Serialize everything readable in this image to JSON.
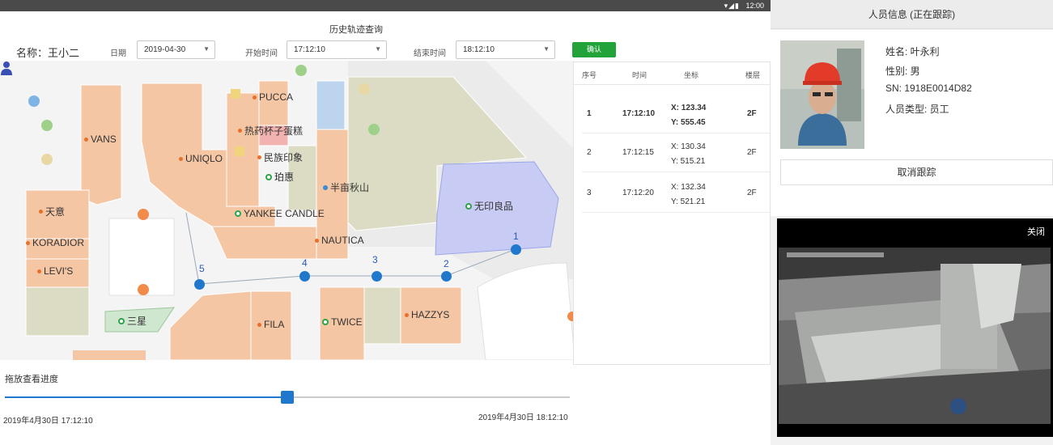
{
  "status_bar": {
    "icons": "▾◢▮",
    "time": "12:00"
  },
  "header": {
    "title": "历史轨迹查询"
  },
  "filters": {
    "name_label": "名称：王小二",
    "date_label": "日期",
    "date_value": "2019-04-30",
    "start_label": "开始时间",
    "start_value": "17:12:10",
    "end_label": "结束时间",
    "end_value": "18:12:10",
    "confirm_label": "确认"
  },
  "map": {
    "pois": [
      {
        "name": "PUCCA",
        "kind": "shop"
      },
      {
        "name": "VANS",
        "kind": "shop"
      },
      {
        "name": "热药杯子蛋糕",
        "kind": "shop"
      },
      {
        "name": "UNIQLO",
        "kind": "shop"
      },
      {
        "name": "民族印象",
        "kind": "shop"
      },
      {
        "name": "珀惠",
        "kind": "service"
      },
      {
        "name": "半亩秋山",
        "kind": "info"
      },
      {
        "name": "天意",
        "kind": "shop"
      },
      {
        "name": "YANKEE CANDLE",
        "kind": "service"
      },
      {
        "name": "无印良品",
        "kind": "service"
      },
      {
        "name": "KORADIOR",
        "kind": "shop"
      },
      {
        "name": "NAUTICA",
        "kind": "shop"
      },
      {
        "name": "LEVI'S",
        "kind": "shop"
      },
      {
        "name": "三星",
        "kind": "service"
      },
      {
        "name": "FILA",
        "kind": "shop"
      },
      {
        "name": "TWICE",
        "kind": "service"
      },
      {
        "name": "HAZZYS",
        "kind": "shop"
      }
    ],
    "markers": [
      "1",
      "2",
      "3",
      "4",
      "5"
    ]
  },
  "table": {
    "headers": [
      "序号",
      "时间",
      "坐标",
      "楼层"
    ],
    "rows": [
      {
        "index": "1",
        "time": "17:12:10",
        "x": "X: 123.34",
        "y": "Y: 555.45",
        "floor": "2F"
      },
      {
        "index": "2",
        "time": "17:12:15",
        "x": "X: 130.34",
        "y": "Y: 515.21",
        "floor": "2F"
      },
      {
        "index": "3",
        "time": "17:12:20",
        "x": "X: 132.34",
        "y": "Y: 521.21",
        "floor": "2F"
      }
    ]
  },
  "playback": {
    "label": "拖放查看进度",
    "start": "2019年4月30日 17:12:10",
    "end": "2019年4月30日 18:12:10",
    "progress": 0.5
  },
  "person": {
    "panel_title": "人员信息 (正在跟踪)",
    "name": "姓名: 叶永利",
    "gender": "性别: 男",
    "sn": "SN: 1918E0014D82",
    "type": "人员类型: 员工",
    "untrack_label": "取消跟踪"
  },
  "video": {
    "close_label": "关闭"
  },
  "colors": {
    "accent": "#1f78cc",
    "confirm": "#22a33a",
    "shop": "#f4c6a4",
    "park": "#dcdcc4",
    "muji": "#c8ccf4"
  }
}
